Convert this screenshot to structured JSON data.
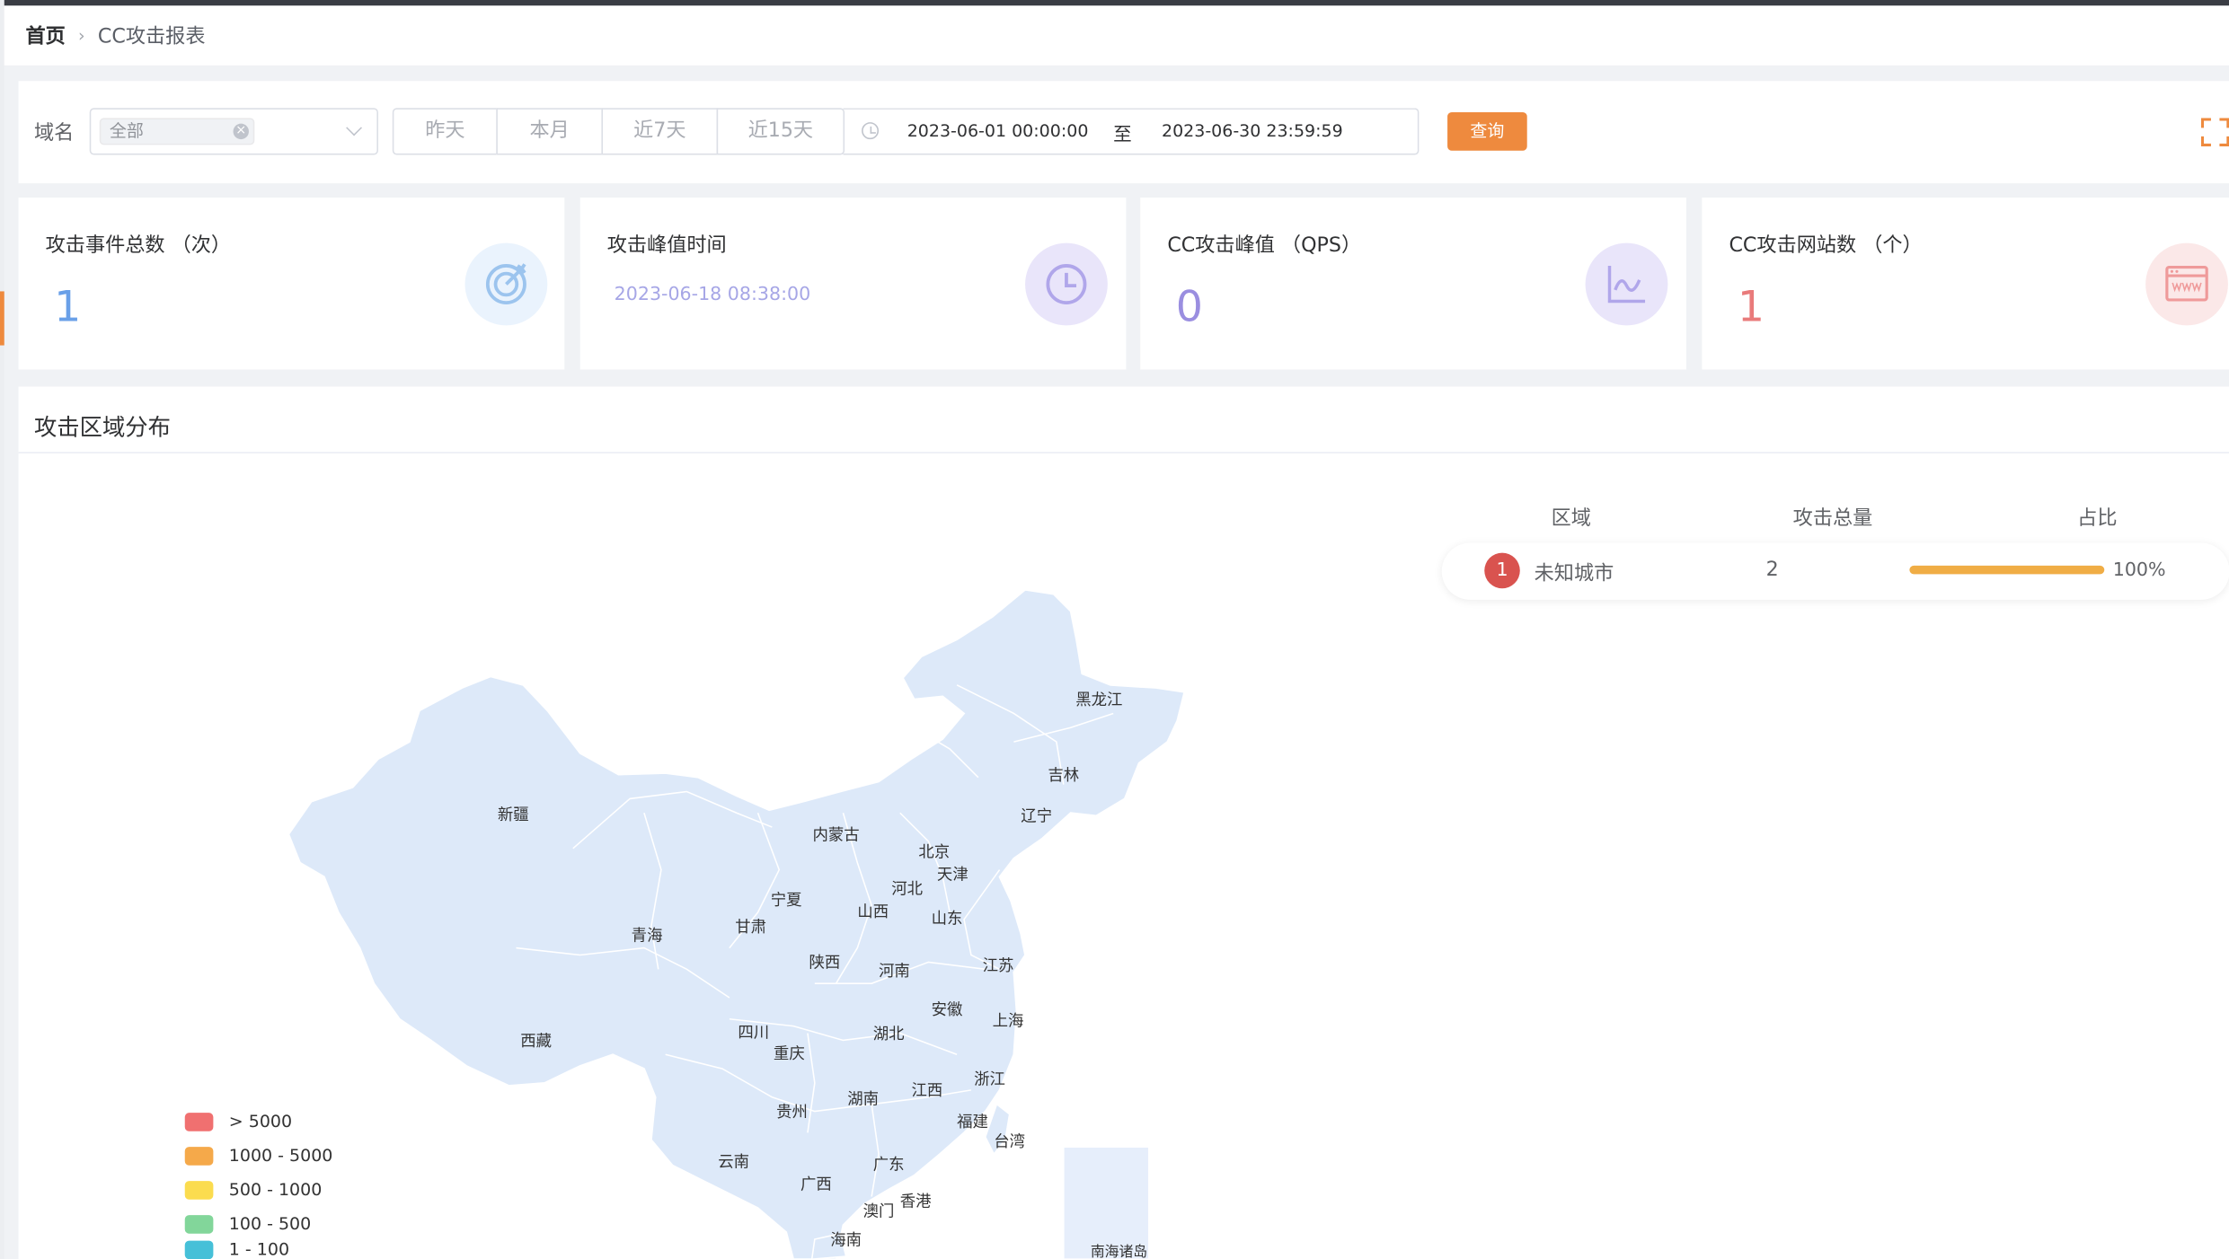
{
  "breadcrumb": {
    "home": "首页",
    "separator": "›",
    "current": "CC攻击报表"
  },
  "filter": {
    "domain_label": "域名",
    "domain_tag": "全部",
    "ranges": [
      "昨天",
      "本月",
      "近7天",
      "近15天"
    ],
    "start": "2023-06-01 00:00:00",
    "range_sep": "至",
    "end": "2023-06-30 23:59:59",
    "query_label": "查询"
  },
  "stats": [
    {
      "title": "攻击事件总数 （次）",
      "value": "1",
      "color": "#6aa0e8",
      "icon": "target-icon"
    },
    {
      "title": "攻击峰值时间",
      "value": "2023-06-18 08:38:00",
      "color": "#a6a6e6",
      "icon": "clock-icon"
    },
    {
      "title": "CC攻击峰值 （QPS）",
      "value": "0",
      "color": "#9a8ee0",
      "icon": "wave-chart-icon"
    },
    {
      "title": "CC攻击网站数 （个）",
      "value": "1",
      "color": "#e97b7b",
      "icon": "website-icon"
    }
  ],
  "region": {
    "title": "攻击区域分布",
    "headers": [
      "区域",
      "攻击总量",
      "占比"
    ],
    "rows": [
      {
        "rank": "1",
        "city": "未知城市",
        "count": "2",
        "share": 1.0,
        "share_label": "100%"
      }
    ]
  },
  "legend": [
    {
      "label": "> 5000",
      "color": "#f07070"
    },
    {
      "label": "1000 - 5000",
      "color": "#f5a94a"
    },
    {
      "label": "500 - 1000",
      "color": "#fbdc4f"
    },
    {
      "label": "100 - 500",
      "color": "#82d69a"
    },
    {
      "label": "1 - 100",
      "color": "#46c0d8"
    }
  ],
  "map": {
    "fill": "#dde9f9",
    "provinces": [
      "黑龙江",
      "吉林",
      "辽宁",
      "内蒙古",
      "北京",
      "天津",
      "新疆",
      "宁夏",
      "河北",
      "山西",
      "山东",
      "青海",
      "甘肃",
      "陕西",
      "河南",
      "江苏",
      "安徽",
      "上海",
      "四川",
      "湖北",
      "西藏",
      "重庆",
      "浙江",
      "湖南",
      "江西",
      "贵州",
      "福建",
      "台湾",
      "云南",
      "广东",
      "广西",
      "香港",
      "澳门",
      "海南",
      "南海诸岛"
    ]
  }
}
